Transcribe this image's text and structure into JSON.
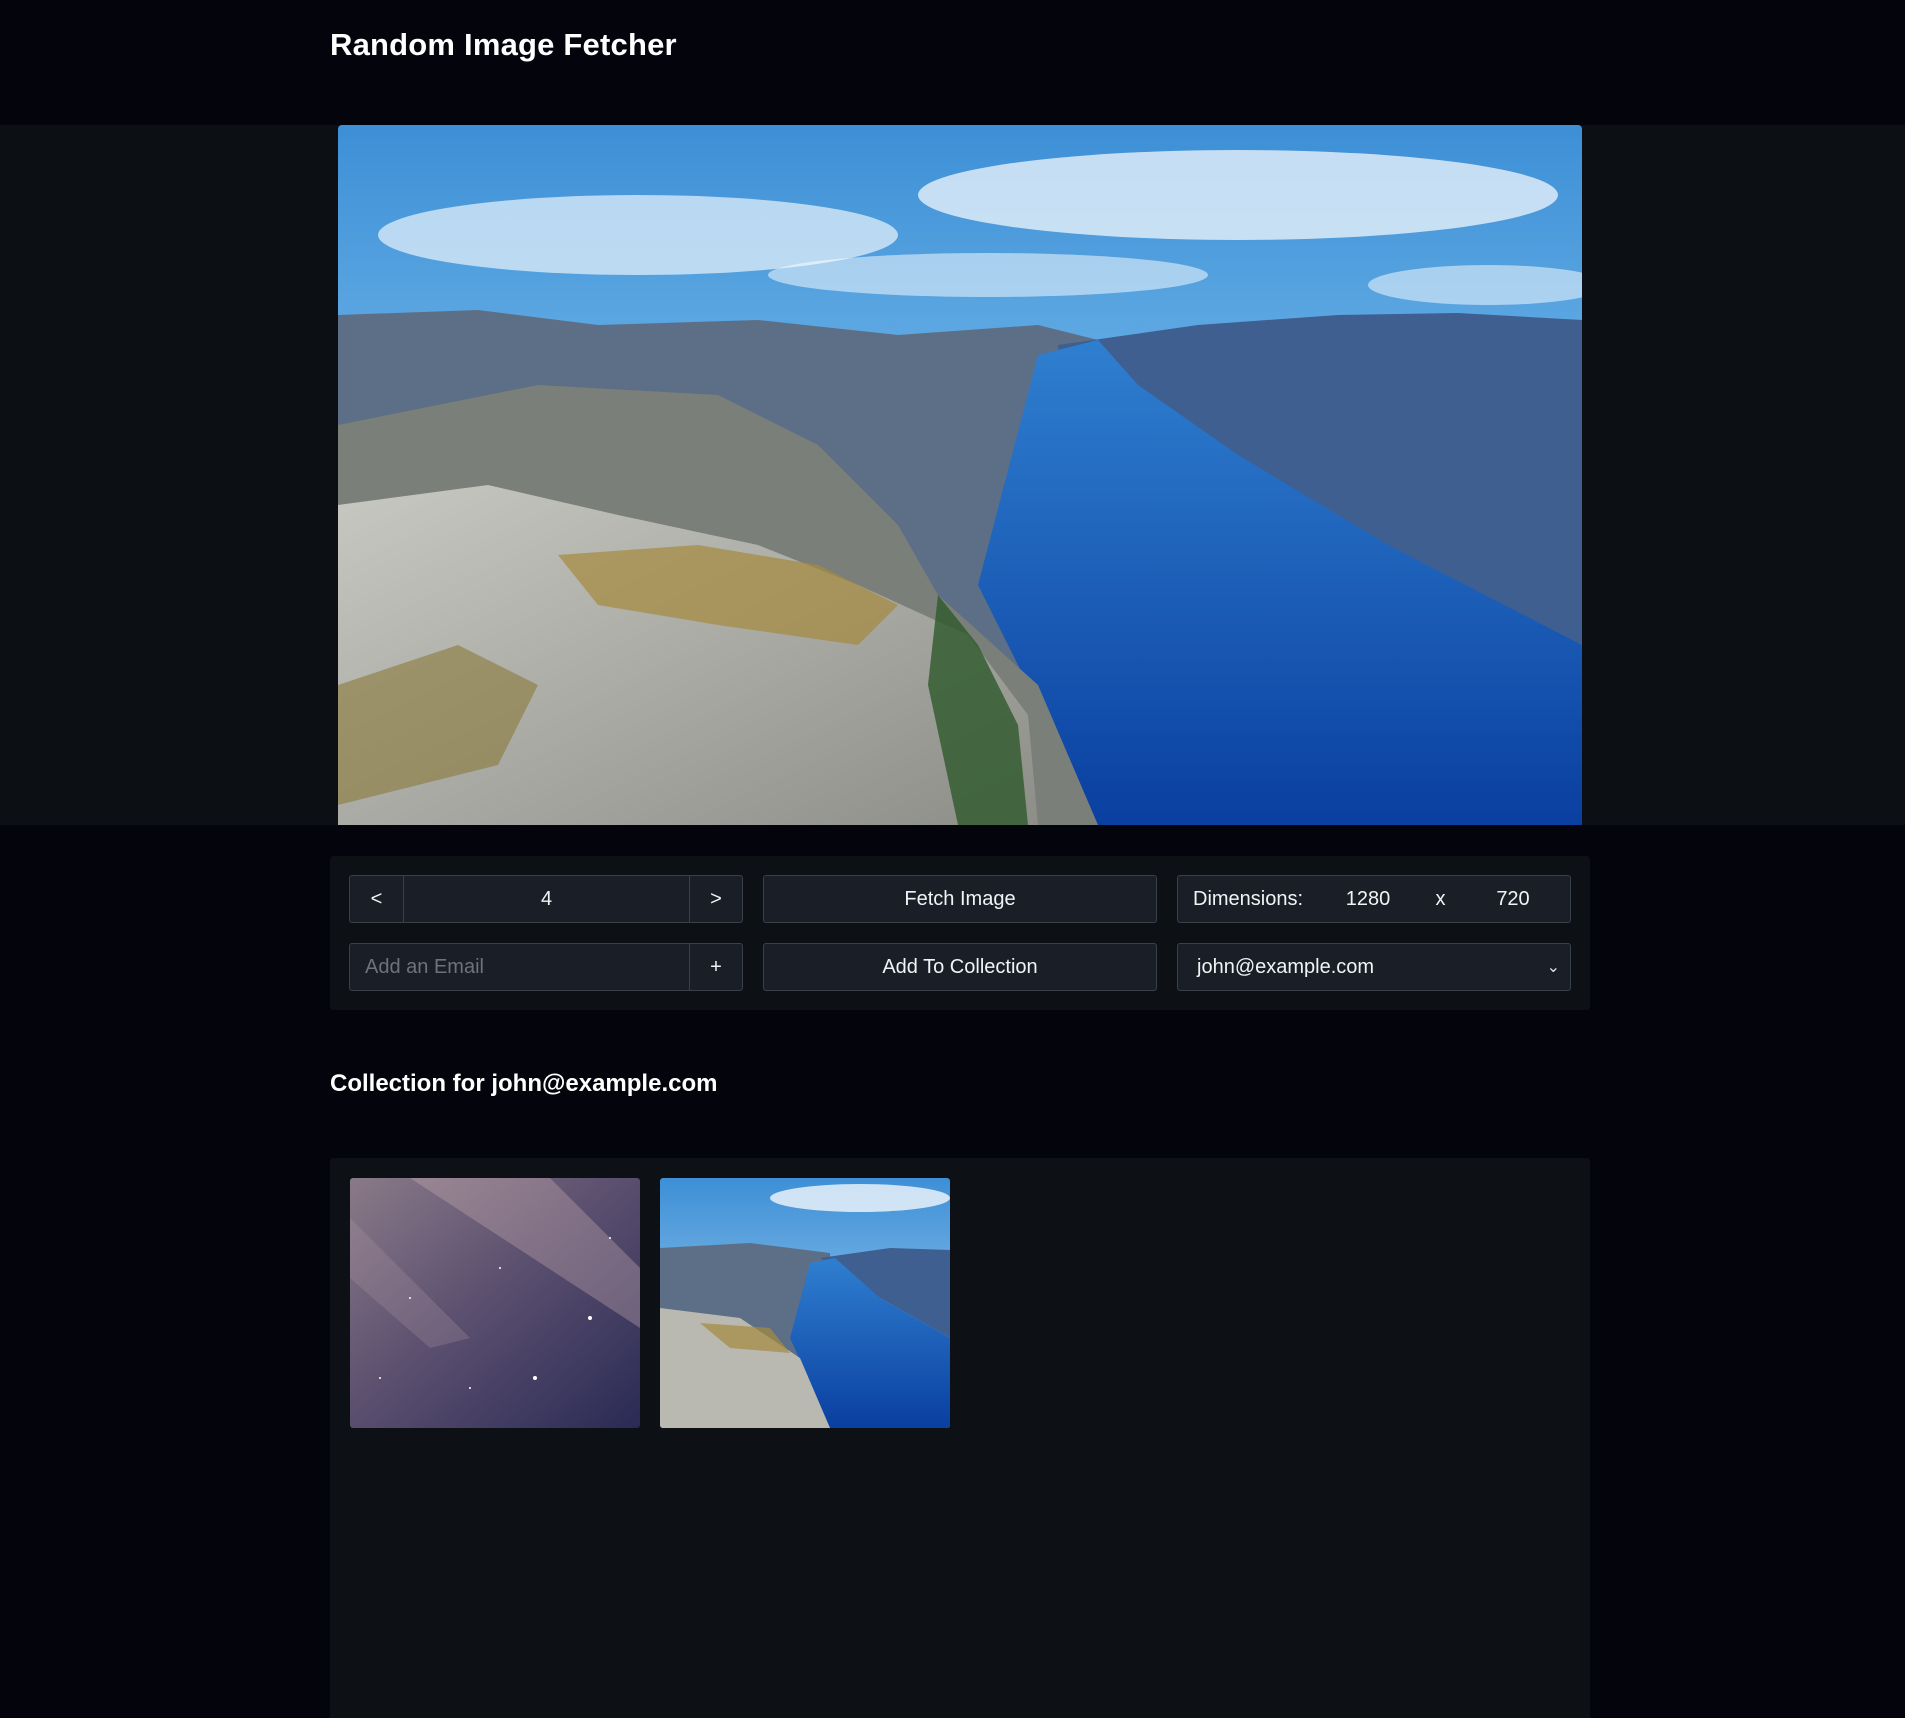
{
  "app": {
    "title": "Random Image Fetcher"
  },
  "viewer": {
    "image_icon": "landscape-fjord-photo"
  },
  "controls": {
    "prev_label": "<",
    "index_value": "4",
    "next_label": ">",
    "fetch_label": "Fetch Image",
    "dimensions_label": "Dimensions:",
    "width_value": "1280",
    "times_label": "x",
    "height_value": "720",
    "email_placeholder": "Add an Email",
    "email_value": "",
    "add_email_label": "+",
    "add_to_collection_label": "Add To Collection",
    "selected_user": "john@example.com"
  },
  "collection": {
    "title": "Collection for john@example.com",
    "items": [
      {
        "icon": "night-sky-stars-photo"
      },
      {
        "icon": "landscape-fjord-photo"
      }
    ]
  },
  "colors": {
    "background": "#03040c",
    "panel": "#0d1015",
    "control": "#1a1f27",
    "border": "#3a4049"
  }
}
